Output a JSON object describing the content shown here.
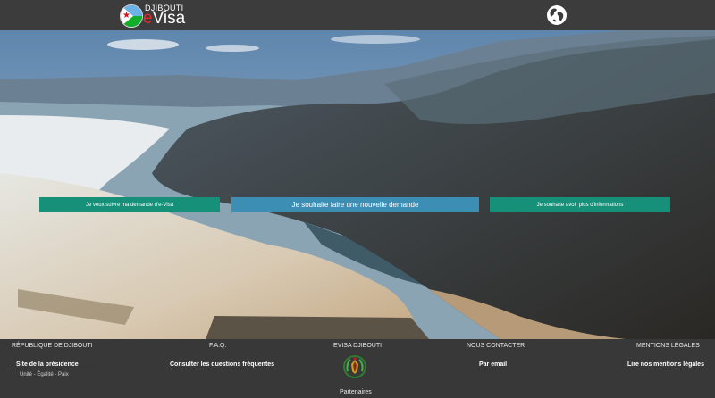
{
  "header": {
    "logo_top": "DJIBOUTI",
    "logo_e": "e",
    "logo_rest": "Visa"
  },
  "hero": {
    "buttons": {
      "follow": "Je veux suivre ma demande d'e-Visa",
      "new": "Je souhaite faire une nouvelle demande",
      "info": "Je souhaite avoir plus d'informations"
    }
  },
  "footer": {
    "columns": [
      {
        "heading": "RÉPUBLIQUE DE DJIBOUTI",
        "link": "Site de la présidence",
        "sub": "Unité - Égalité - Paix"
      },
      {
        "heading": "F.A.Q.",
        "link": "Consulter les questions fréquentes"
      },
      {
        "heading": "EVISA DJIBOUTI"
      },
      {
        "heading": "NOUS CONTACTER",
        "link": "Par email"
      },
      {
        "heading": "MENTIONS LÉGALES",
        "link": "Lire nos mentions légales"
      }
    ],
    "partners": "Partenaires"
  },
  "colors": {
    "follow_button": "#169079",
    "new_button": "#3d8eb5",
    "info_button": "#169079",
    "topbar": "#3c3c3c",
    "footer": "#383838"
  },
  "icons": {
    "globe": "globe-icon",
    "flag": "djibouti-flag-icon",
    "emblem": "coat-of-arms-icon"
  }
}
